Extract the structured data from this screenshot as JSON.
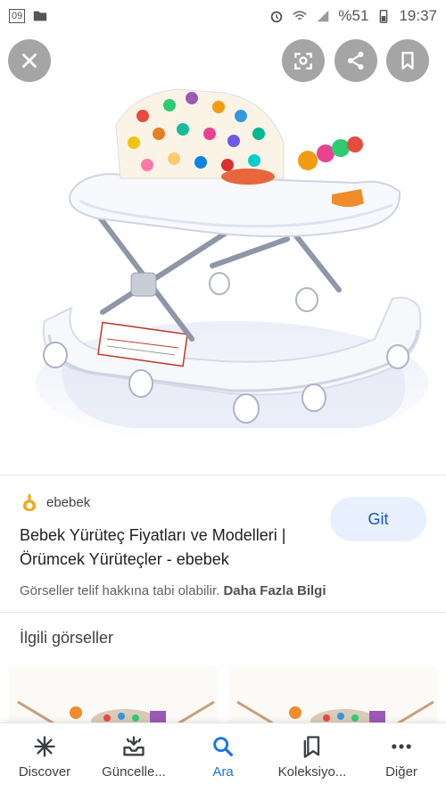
{
  "status_bar": {
    "left_badge": "09",
    "battery": "%51",
    "time": "19:37"
  },
  "source": {
    "name": "ebebek",
    "title": "Bebek Yürüteç Fiyatları ve Modelleri | Örümcek Yürüteçler - ebebek",
    "visit_label": "Git",
    "copyright_text": "Görseller telif hakkına tabi olabilir.",
    "more_info_label": "Daha Fazla Bilgi"
  },
  "related": {
    "title": "İlgili görseller"
  },
  "bottom_nav": {
    "items": [
      {
        "label": "Discover",
        "icon": "asterisk-icon"
      },
      {
        "label": "Güncelle...",
        "icon": "updates-tray-icon"
      },
      {
        "label": "Ara",
        "icon": "search-icon"
      },
      {
        "label": "Koleksiyo...",
        "icon": "collections-icon"
      },
      {
        "label": "Diğer",
        "icon": "more-dots-icon"
      }
    ]
  },
  "colors": {
    "accent": "#1a73e8",
    "button_bg": "#e8f0fe",
    "overlay": "#6e6e6e"
  }
}
